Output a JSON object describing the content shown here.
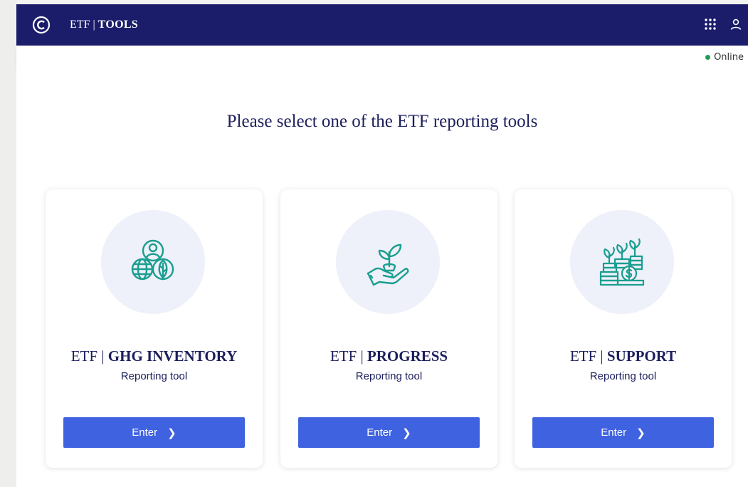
{
  "header": {
    "brand_prefix": "ETF",
    "brand_separator": "|",
    "brand_name": "TOOLS",
    "icons": {
      "logo": "copyright-circle-logo",
      "apps": "grid-apps-icon",
      "user": "user-icon"
    },
    "background_color": "#1b1d6b"
  },
  "status": {
    "label": "Online",
    "dot_color": "#1f9d55"
  },
  "main": {
    "heading": "Please select one of the ETF reporting tools"
  },
  "cards": [
    {
      "prefix": "ETF",
      "separator": "|",
      "name": "GHG INVENTORY",
      "subtitle": "Reporting tool",
      "button_label": "Enter",
      "icon": "people-globe-leaf-icon"
    },
    {
      "prefix": "ETF",
      "separator": "|",
      "name": "PROGRESS",
      "subtitle": "Reporting tool",
      "button_label": "Enter",
      "icon": "hand-sprout-icon"
    },
    {
      "prefix": "ETF",
      "separator": "|",
      "name": "SUPPORT",
      "subtitle": "Reporting tool",
      "button_label": "Enter",
      "icon": "coins-plants-icon"
    }
  ],
  "colors": {
    "accent": "#3f63e0",
    "icon_teal": "#1a9e8f",
    "title": "#1c1f5c"
  }
}
